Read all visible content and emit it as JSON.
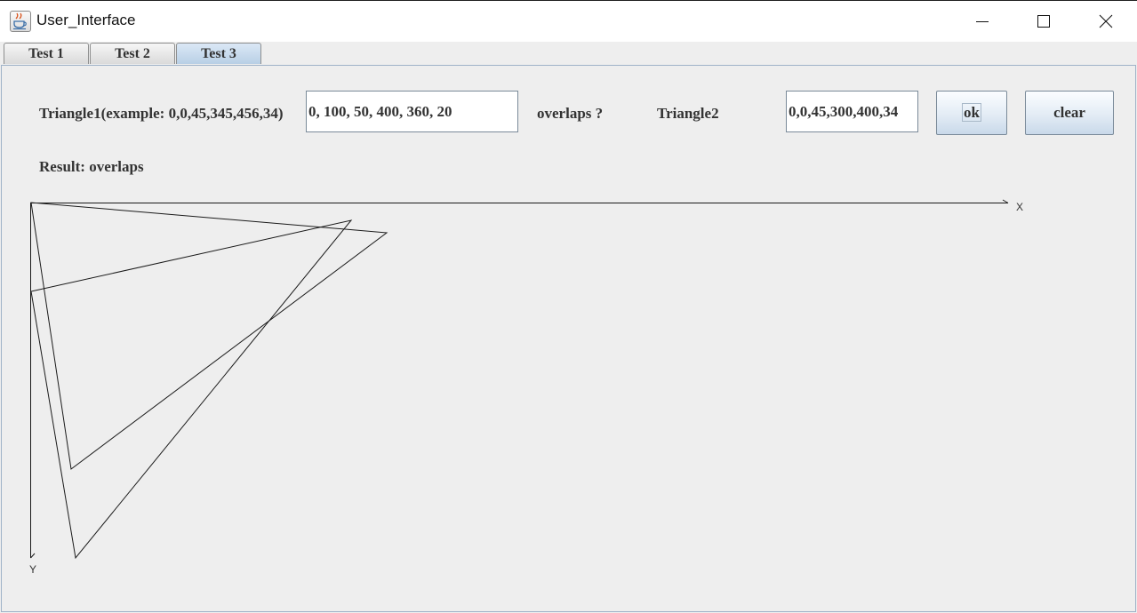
{
  "window": {
    "title": "User_Interface",
    "icon": "java-coffee-icon",
    "controls": [
      "minimize-icon",
      "maximize-icon",
      "close-icon"
    ]
  },
  "tabs": [
    {
      "label": "Test 1",
      "selected": false
    },
    {
      "label": "Test 2",
      "selected": false
    },
    {
      "label": "Test 3",
      "selected": true
    }
  ],
  "form": {
    "triangle1_label": "Triangle1(example: 0,0,45,345,456,34)",
    "triangle1_value": "0, 100, 50, 400, 360, 20",
    "overlaps_label": "overlaps ?",
    "triangle2_label": "Triangle2",
    "triangle2_value": "0,0,45,300,400,34",
    "ok_label": "ok",
    "clear_label": "clear"
  },
  "result": {
    "text": "Result: overlaps"
  },
  "plot": {
    "x_axis_label": "X",
    "y_axis_label": "Y",
    "triangle1": [
      [
        0,
        100
      ],
      [
        50,
        400
      ],
      [
        360,
        20
      ]
    ],
    "triangle2": [
      [
        0,
        0
      ],
      [
        45,
        300
      ],
      [
        400,
        34
      ]
    ],
    "line_color": "#1a1a1a"
  },
  "colors": {
    "background": "#eeeeee",
    "selected_tab": "#b8cfe5"
  }
}
